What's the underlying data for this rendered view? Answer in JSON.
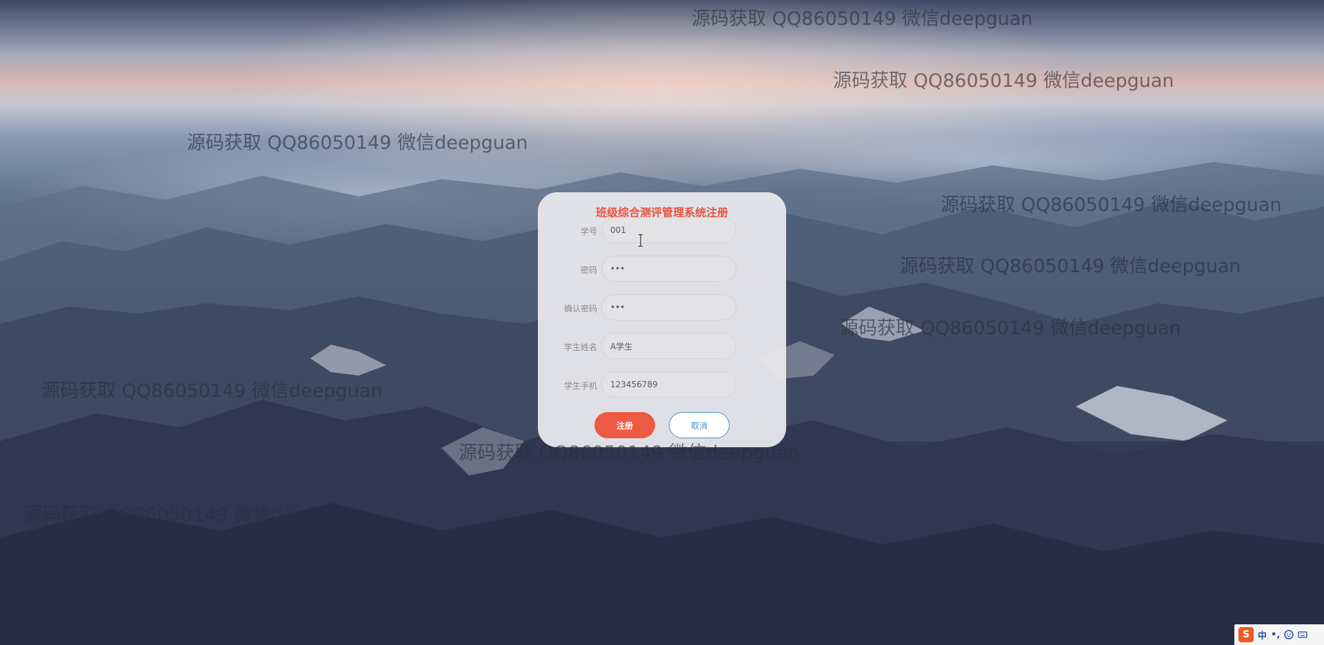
{
  "registration": {
    "title": "班级综合测评管理系统注册",
    "fields": [
      {
        "label": "学号",
        "value": "001",
        "type": "text"
      },
      {
        "label": "密码",
        "value": "•••",
        "type": "password"
      },
      {
        "label": "确认密码",
        "value": "•••",
        "type": "password"
      },
      {
        "label": "学生姓名",
        "value": "A学生",
        "type": "text"
      },
      {
        "label": "学生手机",
        "value": "123456789",
        "type": "text"
      }
    ],
    "register_label": "注册",
    "cancel_label": "取消"
  },
  "watermark": {
    "text": "源码获取 QQ86050149 微信deepguan"
  },
  "taskbar": {
    "ime_logo": "S",
    "ime_mode": "中",
    "ime_symbols": "•,"
  },
  "colors": {
    "title": "#e8523f",
    "register_button": "#ec5a43",
    "cancel_border": "#4a90c8"
  }
}
